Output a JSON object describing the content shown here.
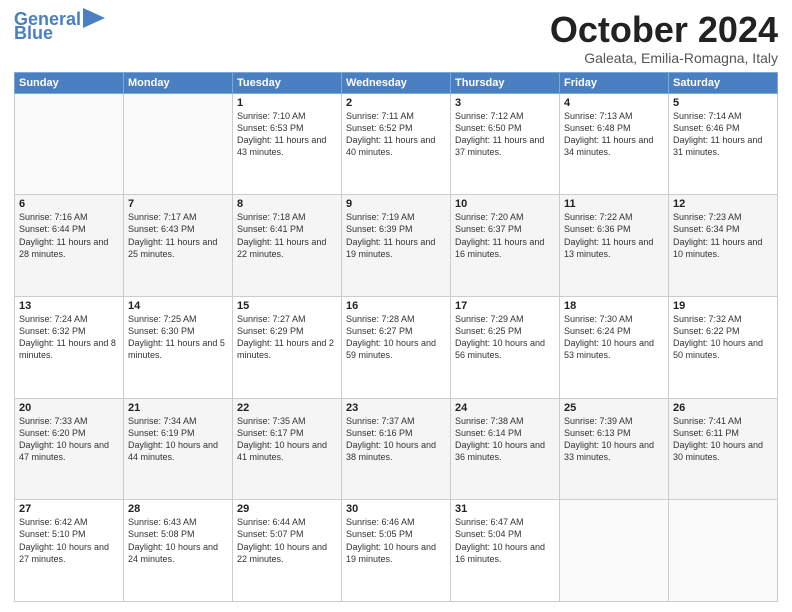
{
  "header": {
    "logo_line1": "General",
    "logo_line2": "Blue",
    "month": "October 2024",
    "location": "Galeata, Emilia-Romagna, Italy"
  },
  "weekdays": [
    "Sunday",
    "Monday",
    "Tuesday",
    "Wednesday",
    "Thursday",
    "Friday",
    "Saturday"
  ],
  "weeks": [
    [
      {
        "day": "",
        "info": ""
      },
      {
        "day": "",
        "info": ""
      },
      {
        "day": "1",
        "info": "Sunrise: 7:10 AM\nSunset: 6:53 PM\nDaylight: 11 hours and 43 minutes."
      },
      {
        "day": "2",
        "info": "Sunrise: 7:11 AM\nSunset: 6:52 PM\nDaylight: 11 hours and 40 minutes."
      },
      {
        "day": "3",
        "info": "Sunrise: 7:12 AM\nSunset: 6:50 PM\nDaylight: 11 hours and 37 minutes."
      },
      {
        "day": "4",
        "info": "Sunrise: 7:13 AM\nSunset: 6:48 PM\nDaylight: 11 hours and 34 minutes."
      },
      {
        "day": "5",
        "info": "Sunrise: 7:14 AM\nSunset: 6:46 PM\nDaylight: 11 hours and 31 minutes."
      }
    ],
    [
      {
        "day": "6",
        "info": "Sunrise: 7:16 AM\nSunset: 6:44 PM\nDaylight: 11 hours and 28 minutes."
      },
      {
        "day": "7",
        "info": "Sunrise: 7:17 AM\nSunset: 6:43 PM\nDaylight: 11 hours and 25 minutes."
      },
      {
        "day": "8",
        "info": "Sunrise: 7:18 AM\nSunset: 6:41 PM\nDaylight: 11 hours and 22 minutes."
      },
      {
        "day": "9",
        "info": "Sunrise: 7:19 AM\nSunset: 6:39 PM\nDaylight: 11 hours and 19 minutes."
      },
      {
        "day": "10",
        "info": "Sunrise: 7:20 AM\nSunset: 6:37 PM\nDaylight: 11 hours and 16 minutes."
      },
      {
        "day": "11",
        "info": "Sunrise: 7:22 AM\nSunset: 6:36 PM\nDaylight: 11 hours and 13 minutes."
      },
      {
        "day": "12",
        "info": "Sunrise: 7:23 AM\nSunset: 6:34 PM\nDaylight: 11 hours and 10 minutes."
      }
    ],
    [
      {
        "day": "13",
        "info": "Sunrise: 7:24 AM\nSunset: 6:32 PM\nDaylight: 11 hours and 8 minutes."
      },
      {
        "day": "14",
        "info": "Sunrise: 7:25 AM\nSunset: 6:30 PM\nDaylight: 11 hours and 5 minutes."
      },
      {
        "day": "15",
        "info": "Sunrise: 7:27 AM\nSunset: 6:29 PM\nDaylight: 11 hours and 2 minutes."
      },
      {
        "day": "16",
        "info": "Sunrise: 7:28 AM\nSunset: 6:27 PM\nDaylight: 10 hours and 59 minutes."
      },
      {
        "day": "17",
        "info": "Sunrise: 7:29 AM\nSunset: 6:25 PM\nDaylight: 10 hours and 56 minutes."
      },
      {
        "day": "18",
        "info": "Sunrise: 7:30 AM\nSunset: 6:24 PM\nDaylight: 10 hours and 53 minutes."
      },
      {
        "day": "19",
        "info": "Sunrise: 7:32 AM\nSunset: 6:22 PM\nDaylight: 10 hours and 50 minutes."
      }
    ],
    [
      {
        "day": "20",
        "info": "Sunrise: 7:33 AM\nSunset: 6:20 PM\nDaylight: 10 hours and 47 minutes."
      },
      {
        "day": "21",
        "info": "Sunrise: 7:34 AM\nSunset: 6:19 PM\nDaylight: 10 hours and 44 minutes."
      },
      {
        "day": "22",
        "info": "Sunrise: 7:35 AM\nSunset: 6:17 PM\nDaylight: 10 hours and 41 minutes."
      },
      {
        "day": "23",
        "info": "Sunrise: 7:37 AM\nSunset: 6:16 PM\nDaylight: 10 hours and 38 minutes."
      },
      {
        "day": "24",
        "info": "Sunrise: 7:38 AM\nSunset: 6:14 PM\nDaylight: 10 hours and 36 minutes."
      },
      {
        "day": "25",
        "info": "Sunrise: 7:39 AM\nSunset: 6:13 PM\nDaylight: 10 hours and 33 minutes."
      },
      {
        "day": "26",
        "info": "Sunrise: 7:41 AM\nSunset: 6:11 PM\nDaylight: 10 hours and 30 minutes."
      }
    ],
    [
      {
        "day": "27",
        "info": "Sunrise: 6:42 AM\nSunset: 5:10 PM\nDaylight: 10 hours and 27 minutes."
      },
      {
        "day": "28",
        "info": "Sunrise: 6:43 AM\nSunset: 5:08 PM\nDaylight: 10 hours and 24 minutes."
      },
      {
        "day": "29",
        "info": "Sunrise: 6:44 AM\nSunset: 5:07 PM\nDaylight: 10 hours and 22 minutes."
      },
      {
        "day": "30",
        "info": "Sunrise: 6:46 AM\nSunset: 5:05 PM\nDaylight: 10 hours and 19 minutes."
      },
      {
        "day": "31",
        "info": "Sunrise: 6:47 AM\nSunset: 5:04 PM\nDaylight: 10 hours and 16 minutes."
      },
      {
        "day": "",
        "info": ""
      },
      {
        "day": "",
        "info": ""
      }
    ]
  ]
}
